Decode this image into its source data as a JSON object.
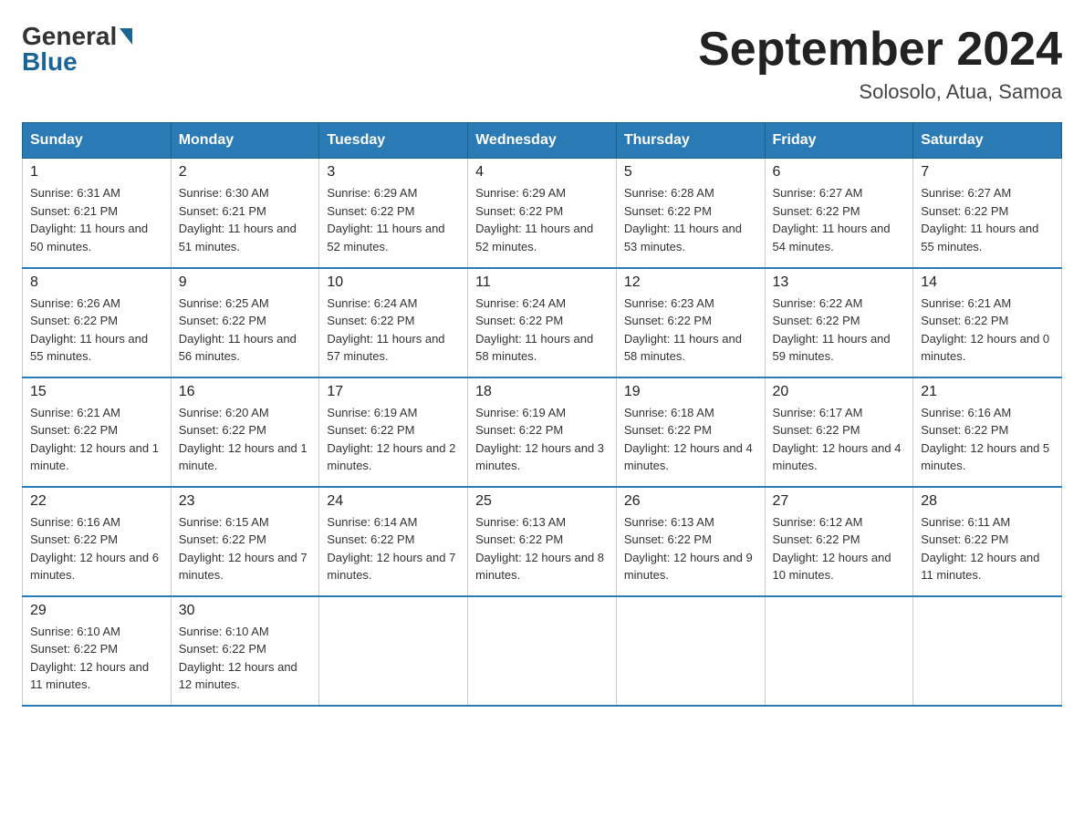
{
  "logo": {
    "general": "General",
    "blue": "Blue"
  },
  "header": {
    "title": "September 2024",
    "subtitle": "Solosolo, Atua, Samoa"
  },
  "days_of_week": [
    "Sunday",
    "Monday",
    "Tuesday",
    "Wednesday",
    "Thursday",
    "Friday",
    "Saturday"
  ],
  "weeks": [
    [
      {
        "day": "1",
        "sunrise": "6:31 AM",
        "sunset": "6:21 PM",
        "daylight": "11 hours and 50 minutes."
      },
      {
        "day": "2",
        "sunrise": "6:30 AM",
        "sunset": "6:21 PM",
        "daylight": "11 hours and 51 minutes."
      },
      {
        "day": "3",
        "sunrise": "6:29 AM",
        "sunset": "6:22 PM",
        "daylight": "11 hours and 52 minutes."
      },
      {
        "day": "4",
        "sunrise": "6:29 AM",
        "sunset": "6:22 PM",
        "daylight": "11 hours and 52 minutes."
      },
      {
        "day": "5",
        "sunrise": "6:28 AM",
        "sunset": "6:22 PM",
        "daylight": "11 hours and 53 minutes."
      },
      {
        "day": "6",
        "sunrise": "6:27 AM",
        "sunset": "6:22 PM",
        "daylight": "11 hours and 54 minutes."
      },
      {
        "day": "7",
        "sunrise": "6:27 AM",
        "sunset": "6:22 PM",
        "daylight": "11 hours and 55 minutes."
      }
    ],
    [
      {
        "day": "8",
        "sunrise": "6:26 AM",
        "sunset": "6:22 PM",
        "daylight": "11 hours and 55 minutes."
      },
      {
        "day": "9",
        "sunrise": "6:25 AM",
        "sunset": "6:22 PM",
        "daylight": "11 hours and 56 minutes."
      },
      {
        "day": "10",
        "sunrise": "6:24 AM",
        "sunset": "6:22 PM",
        "daylight": "11 hours and 57 minutes."
      },
      {
        "day": "11",
        "sunrise": "6:24 AM",
        "sunset": "6:22 PM",
        "daylight": "11 hours and 58 minutes."
      },
      {
        "day": "12",
        "sunrise": "6:23 AM",
        "sunset": "6:22 PM",
        "daylight": "11 hours and 58 minutes."
      },
      {
        "day": "13",
        "sunrise": "6:22 AM",
        "sunset": "6:22 PM",
        "daylight": "11 hours and 59 minutes."
      },
      {
        "day": "14",
        "sunrise": "6:21 AM",
        "sunset": "6:22 PM",
        "daylight": "12 hours and 0 minutes."
      }
    ],
    [
      {
        "day": "15",
        "sunrise": "6:21 AM",
        "sunset": "6:22 PM",
        "daylight": "12 hours and 1 minute."
      },
      {
        "day": "16",
        "sunrise": "6:20 AM",
        "sunset": "6:22 PM",
        "daylight": "12 hours and 1 minute."
      },
      {
        "day": "17",
        "sunrise": "6:19 AM",
        "sunset": "6:22 PM",
        "daylight": "12 hours and 2 minutes."
      },
      {
        "day": "18",
        "sunrise": "6:19 AM",
        "sunset": "6:22 PM",
        "daylight": "12 hours and 3 minutes."
      },
      {
        "day": "19",
        "sunrise": "6:18 AM",
        "sunset": "6:22 PM",
        "daylight": "12 hours and 4 minutes."
      },
      {
        "day": "20",
        "sunrise": "6:17 AM",
        "sunset": "6:22 PM",
        "daylight": "12 hours and 4 minutes."
      },
      {
        "day": "21",
        "sunrise": "6:16 AM",
        "sunset": "6:22 PM",
        "daylight": "12 hours and 5 minutes."
      }
    ],
    [
      {
        "day": "22",
        "sunrise": "6:16 AM",
        "sunset": "6:22 PM",
        "daylight": "12 hours and 6 minutes."
      },
      {
        "day": "23",
        "sunrise": "6:15 AM",
        "sunset": "6:22 PM",
        "daylight": "12 hours and 7 minutes."
      },
      {
        "day": "24",
        "sunrise": "6:14 AM",
        "sunset": "6:22 PM",
        "daylight": "12 hours and 7 minutes."
      },
      {
        "day": "25",
        "sunrise": "6:13 AM",
        "sunset": "6:22 PM",
        "daylight": "12 hours and 8 minutes."
      },
      {
        "day": "26",
        "sunrise": "6:13 AM",
        "sunset": "6:22 PM",
        "daylight": "12 hours and 9 minutes."
      },
      {
        "day": "27",
        "sunrise": "6:12 AM",
        "sunset": "6:22 PM",
        "daylight": "12 hours and 10 minutes."
      },
      {
        "day": "28",
        "sunrise": "6:11 AM",
        "sunset": "6:22 PM",
        "daylight": "12 hours and 11 minutes."
      }
    ],
    [
      {
        "day": "29",
        "sunrise": "6:10 AM",
        "sunset": "6:22 PM",
        "daylight": "12 hours and 11 minutes."
      },
      {
        "day": "30",
        "sunrise": "6:10 AM",
        "sunset": "6:22 PM",
        "daylight": "12 hours and 12 minutes."
      },
      null,
      null,
      null,
      null,
      null
    ]
  ],
  "labels": {
    "sunrise": "Sunrise:",
    "sunset": "Sunset:",
    "daylight": "Daylight:"
  }
}
